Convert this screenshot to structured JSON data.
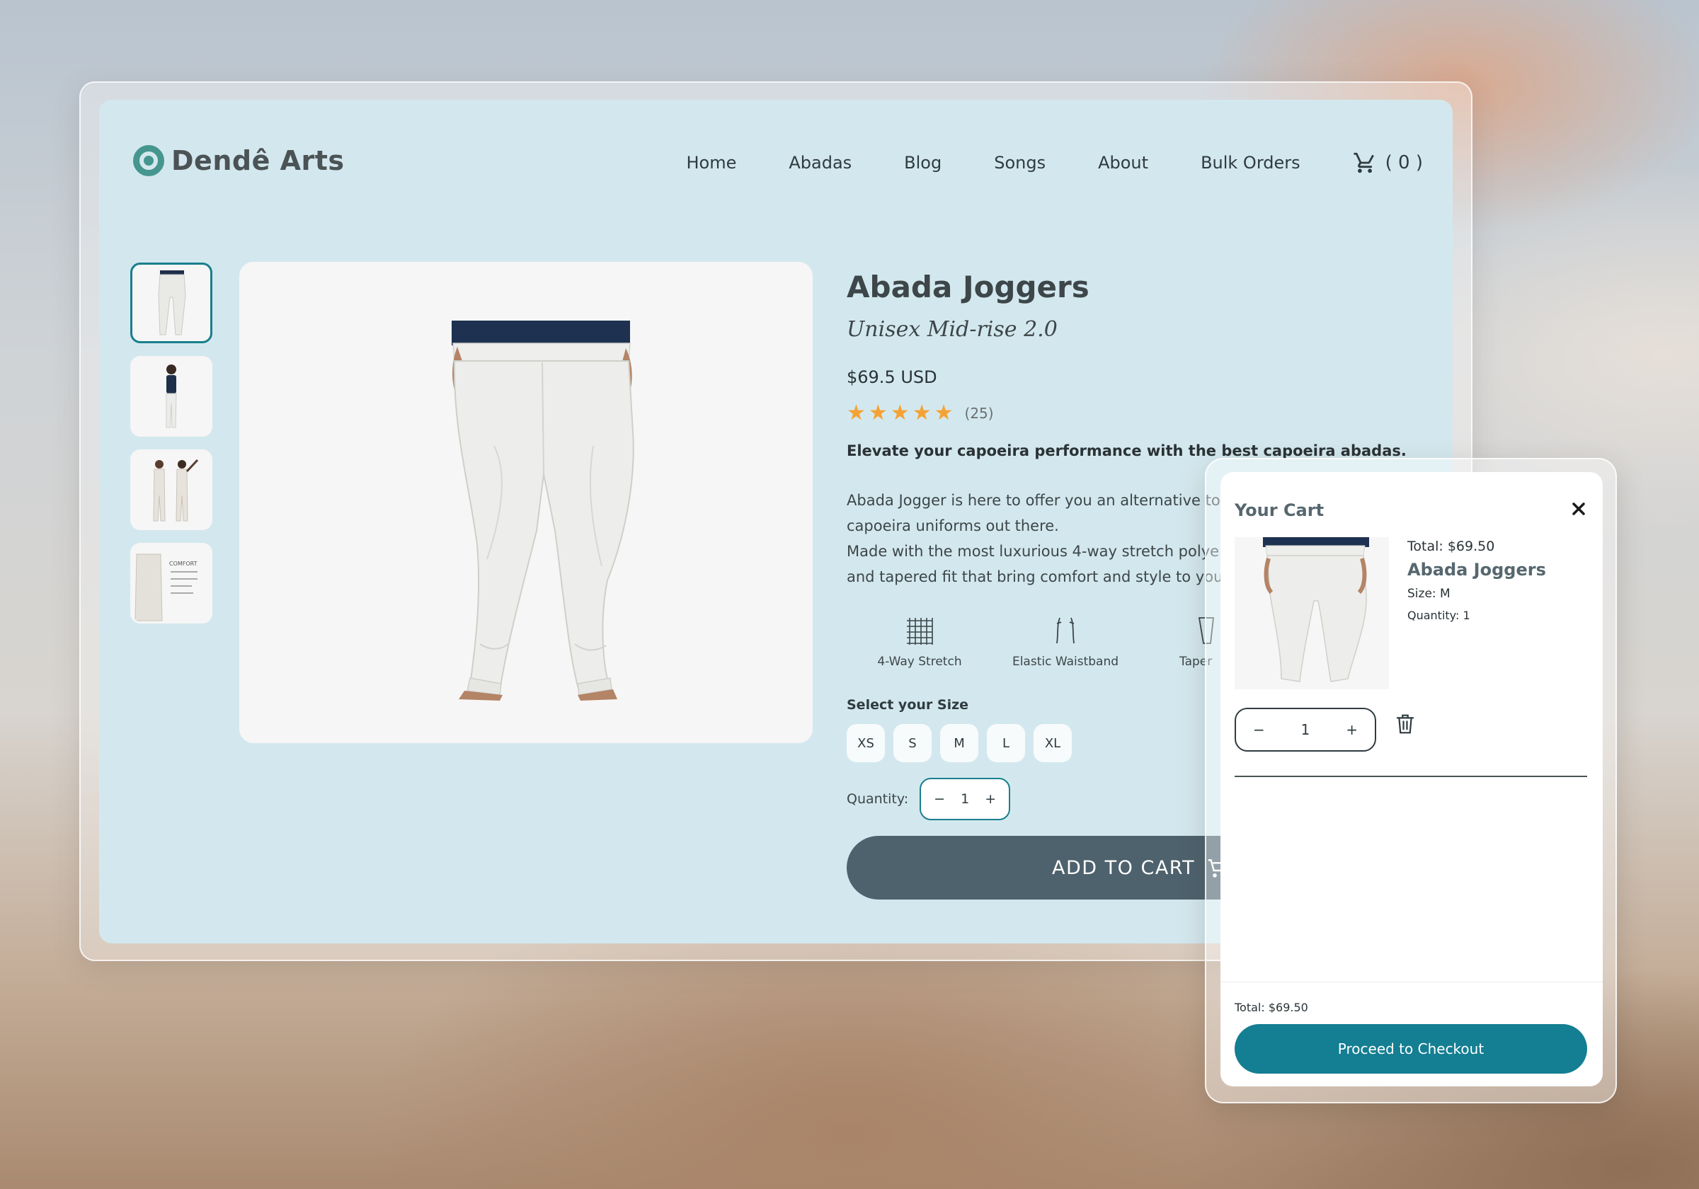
{
  "brand": {
    "name": "Dendê Arts"
  },
  "nav": {
    "items": [
      "Home",
      "Abadas",
      "Blog",
      "Songs",
      "About",
      "Bulk Orders"
    ],
    "cart_count": "(  0  )"
  },
  "product": {
    "title": "Abada Joggers",
    "subtitle": "Unisex Mid-rise 2.0",
    "price": "$69.5 USD",
    "rating": 5,
    "review_count": "(25)",
    "lead": "Elevate your capoeira performance with the best capoeira abadas.",
    "description_lines": [
      "Abada Jogger is here to offer you an alternative to",
      "capoeira uniforms out there.",
      "Made with the most luxurious 4-way stretch polye",
      "and tapered fit that bring comfort and style to you"
    ],
    "features": [
      {
        "label": "4-Way Stretch",
        "icon": "fabric-grid-icon"
      },
      {
        "label": "Elastic Waistband",
        "icon": "waistband-icon"
      },
      {
        "label": "Taper",
        "icon": "tapered-leg-icon"
      }
    ],
    "size_label": "Select your Size",
    "sizes": [
      "XS",
      "S",
      "M",
      "L",
      "XL"
    ],
    "quantity_label": "Quantity:",
    "quantity": "1",
    "qty_minus": "−",
    "qty_plus": "+",
    "add_to_cart": "ADD TO CART",
    "thumb_comfort_text": "COMFORT"
  },
  "cart": {
    "title": "Your Cart",
    "item": {
      "total": "Total: $69.50",
      "name": "Abada Joggers",
      "size": "Size: M",
      "quantity": "Quantity: 1",
      "stepper_value": "1",
      "minus": "−",
      "plus": "+"
    },
    "footer_total": "Total: $69.50",
    "checkout_label": "Proceed to Checkout"
  },
  "colors": {
    "site_bg": "#d3e8ee",
    "accent_teal": "#147e92",
    "add_to_cart_bg": "#4e626d",
    "star": "#f4a234",
    "brand_logo": "#45968f"
  }
}
